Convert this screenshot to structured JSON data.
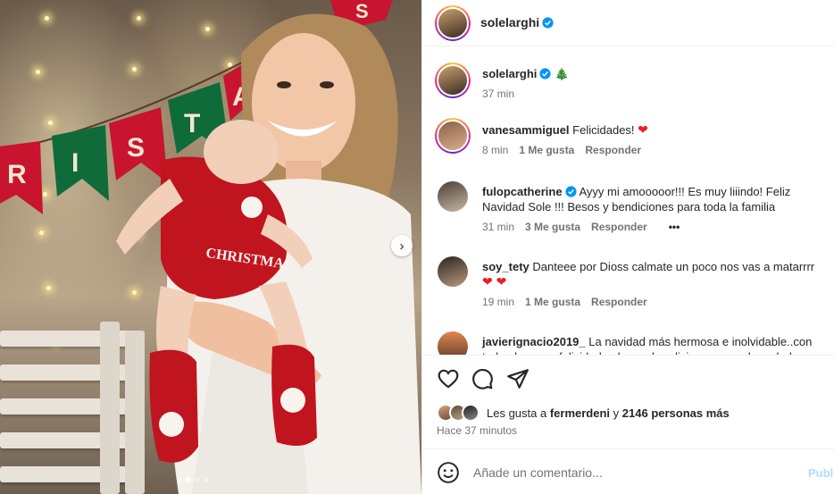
{
  "post": {
    "author": "solelarghi",
    "verified": true,
    "caption_emoji": "🎄",
    "caption_time": "37 min"
  },
  "media": {
    "banner_letters": [
      "R",
      "I",
      "S",
      "T",
      "A",
      "S"
    ],
    "onesie_text": "CHRISTMAS",
    "carousel_dots": 4,
    "carousel_active": 2
  },
  "comments": [
    {
      "user": "vanesammiguel",
      "text": "Felicidades!",
      "emoji": "❤",
      "time": "8 min",
      "likes": "1 Me gusta",
      "reply": "Responder"
    },
    {
      "user": "fulopcatherine",
      "verified": true,
      "text": "Ayyy mi amooooor!!! Es muy liiindo! Feliz Navidad Sole !!! Besos y bendiciones para toda la familia",
      "time": "31 min",
      "likes": "3 Me gusta",
      "reply": "Responder",
      "more": "•••"
    },
    {
      "user": "soy_tety",
      "text": "Danteee por Dioss calmate un poco nos vas a matarrrr",
      "emoji": "❤ ❤",
      "time": "19 min",
      "likes": "1 Me gusta",
      "reply": "Responder"
    },
    {
      "user": "javierignacio2019_",
      "text": "La navidad más hermosa e inolvidable..con todo el amor y felicidad ... besos bendiciones y mucha salud"
    }
  ],
  "likes_line": {
    "prefix": "Les gusta a",
    "user": "fermerdeni",
    "joiner": "y",
    "rest": "2146 personas más"
  },
  "timestamp": "Hace 37 minutos",
  "comment_box": {
    "placeholder": "Añade un comentario...",
    "post_label": "Publicar"
  },
  "colors": {
    "verified": "#0095f6",
    "heart": "#ed1c24",
    "post_button": "#b3dbff",
    "muted": "#737373"
  }
}
